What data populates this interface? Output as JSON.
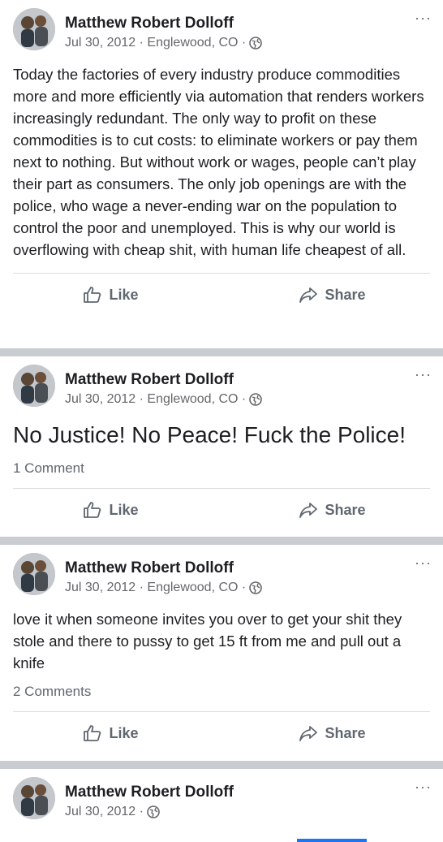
{
  "posts": [
    {
      "author": "Matthew Robert Dolloff",
      "meta": "Jul 30, 2012 · Englewood, CO ·",
      "text": "Today the factories of every industry produce commodities more and more efficiently via automation that renders workers increasingly redundant. The only way to profit on these commodities is to cut costs: to eliminate workers or pay them next to nothing. But without work or wages, people can’t play their part as consumers. The only job openings are with the police, who wage a never-ending war on the population to control the poor and unemployed. This is why our world is overflowing with cheap shit, with human life cheapest of all.",
      "comments": "",
      "like_label": "Like",
      "share_label": "Share"
    },
    {
      "author": "Matthew Robert Dolloff",
      "meta": "Jul 30, 2012 · Englewood, CO ·",
      "text": "No Justice! No Peace! Fuck the Police!",
      "comments": "1 Comment",
      "like_label": "Like",
      "share_label": "Share"
    },
    {
      "author": "Matthew Robert Dolloff",
      "meta": "Jul 30, 2012 · Englewood, CO ·",
      "text": "love it when someone invites you over to get your shit they stole and there to pussy to get 15 ft from me and pull out a knife",
      "comments": "2 Comments",
      "like_label": "Like",
      "share_label": "Share"
    },
    {
      "author": "Matthew Robert Dolloff",
      "meta": "Jul 30, 2012 ·"
    }
  ],
  "more_icon": "···",
  "colors": {
    "feed_bg": "#c9ccd1",
    "text": "#1c1e21",
    "muted": "#65676b",
    "accent": "#1877f2"
  }
}
